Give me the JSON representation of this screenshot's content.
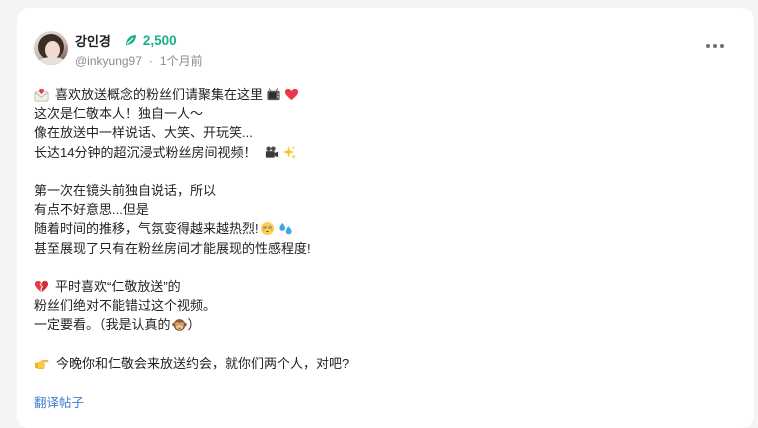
{
  "post": {
    "author": {
      "display_name": "강인경",
      "handle": "@inkyung97",
      "points": "2,500",
      "time_ago": "1个月前"
    },
    "lines": [
      "喜欢放送概念的粉丝们请聚集在这里",
      "这次是仁敬本人！独自一人～",
      "像在放送中一样说话、大笑、开玩笑...",
      "长达14分钟的超沉浸式粉丝房间视频！",
      "",
      "第一次在镜头前独自说话，所以",
      "有点不好意思...但是",
      "随着时间的推移，气氛变得越来越热烈!",
      "甚至展现了只有在粉丝房间才能展现的性感程度!",
      "",
      "平时喜欢“仁敬放送”的",
      "粉丝们绝对不能错过这个视频。",
      "一定要看。（我是认真的",
      "）",
      "今晚你和仁敬会来放送约会，就你们两个人，对吧?"
    ],
    "emojis": [
      "envelope-heart",
      "tv",
      "red-heart",
      "movie-camera",
      "sparkles",
      "flushed-face",
      "sweat-droplets",
      "broken-heart",
      "see-no-evil-monkey",
      "pointing-right"
    ],
    "translate_label": "翻译帖子"
  }
}
